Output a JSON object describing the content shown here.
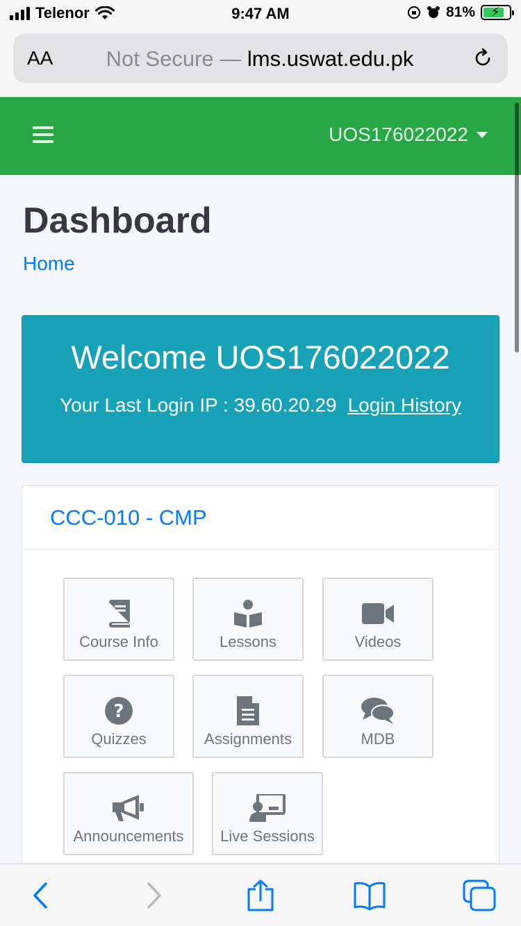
{
  "status": {
    "carrier": "Telenor",
    "time": "9:47 AM",
    "battery": "81%"
  },
  "browser": {
    "text_size": "AA",
    "not_secure": "Not Secure —",
    "domain": "lms.uswat.edu.pk"
  },
  "navbar": {
    "user": "UOS176022022"
  },
  "page": {
    "title": "Dashboard",
    "breadcrumb": "Home"
  },
  "welcome": {
    "heading": "Welcome UOS176022022",
    "ip_text": "Your Last Login IP : 39.60.20.29",
    "history_link": "Login History"
  },
  "course": {
    "title": "CCC-010 - CMP",
    "tiles": [
      {
        "label": "Course Info",
        "icon": "book-icon"
      },
      {
        "label": "Lessons",
        "icon": "reader-icon"
      },
      {
        "label": "Videos",
        "icon": "video-camera-icon"
      },
      {
        "label": "Quizzes",
        "icon": "question-circle-icon"
      },
      {
        "label": "Assignments",
        "icon": "document-icon"
      },
      {
        "label": "MDB",
        "icon": "comments-icon"
      },
      {
        "label": "Announcements",
        "icon": "megaphone-icon"
      },
      {
        "label": "Live Sessions",
        "icon": "presentation-icon"
      }
    ]
  },
  "colors": {
    "navbar": "#28a745",
    "welcome_bg": "#17a2b8",
    "link": "#007bff"
  }
}
